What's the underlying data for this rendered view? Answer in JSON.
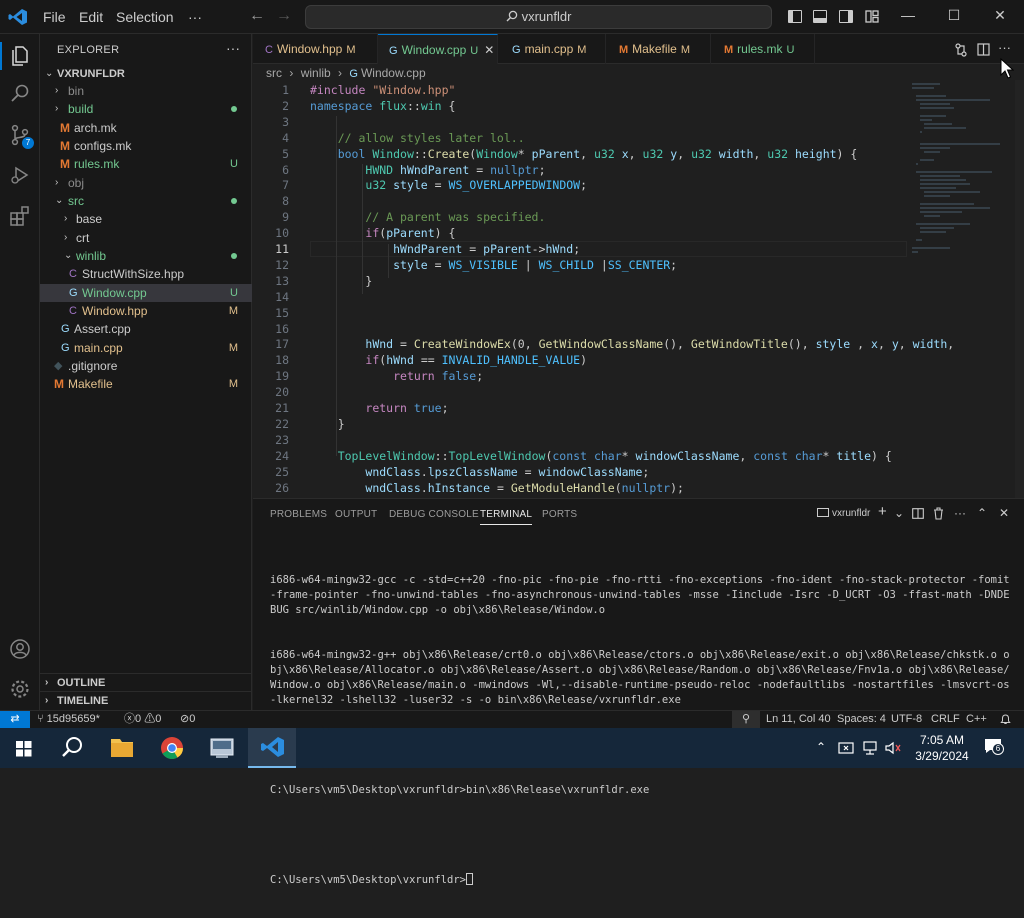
{
  "titlebar": {
    "menus": [
      "File",
      "Edit",
      "Selection"
    ],
    "more": "···",
    "back": "←",
    "forward": "→",
    "search_text": "vxrunfldr",
    "minimize": "—",
    "maximize": "☐",
    "close": "✕"
  },
  "explorer": {
    "title": "EXPLORER",
    "more": "···",
    "root": "VXRUNFLDR",
    "items": [
      {
        "label": "bin",
        "badge": ""
      },
      {
        "label": "build",
        "badge": ""
      },
      {
        "label": "arch.mk",
        "badge": ""
      },
      {
        "label": "configs.mk",
        "badge": ""
      },
      {
        "label": "rules.mk",
        "badge": "U"
      },
      {
        "label": "obj",
        "badge": ""
      },
      {
        "label": "src",
        "badge": ""
      },
      {
        "label": "base",
        "badge": ""
      },
      {
        "label": "crt",
        "badge": ""
      },
      {
        "label": "winlib",
        "badge": ""
      },
      {
        "label": "StructWithSize.hpp",
        "badge": ""
      },
      {
        "label": "Window.cpp",
        "badge": "U"
      },
      {
        "label": "Window.hpp",
        "badge": "M"
      },
      {
        "label": "Assert.cpp",
        "badge": ""
      },
      {
        "label": "main.cpp",
        "badge": "M"
      },
      {
        "label": ".gitignore",
        "badge": ""
      },
      {
        "label": "Makefile",
        "badge": "M"
      }
    ],
    "outline": "OUTLINE",
    "timeline": "TIMELINE"
  },
  "tabs": [
    {
      "label": "Window.hpp",
      "status": "M",
      "icon": "C"
    },
    {
      "label": "Window.cpp",
      "status": "U",
      "icon": "G",
      "close": "✕"
    },
    {
      "label": "main.cpp",
      "status": "M",
      "icon": "G"
    },
    {
      "label": "Makefile",
      "status": "M",
      "icon": "M"
    },
    {
      "label": "rules.mk",
      "status": "U",
      "icon": "M"
    }
  ],
  "breadcrumb": {
    "parts": [
      "src",
      "winlib",
      "Window.cpp"
    ],
    "sep": "›"
  },
  "editor": {
    "lines": [
      {
        "n": "1",
        "text": "#include \"Window.hpp\""
      },
      {
        "n": "2",
        "text": "namespace flux::win {"
      },
      {
        "n": "3",
        "text": ""
      },
      {
        "n": "4",
        "text": "    // allow styles later lol.."
      },
      {
        "n": "5",
        "text": "    bool Window::Create(Window* pParent, u32 x, u32 y, u32 width, u32 height) {"
      },
      {
        "n": "6",
        "text": "        HWND hWndParent = nullptr;"
      },
      {
        "n": "7",
        "text": "        u32 style = WS_OVERLAPPEDWINDOW;"
      },
      {
        "n": "8",
        "text": ""
      },
      {
        "n": "9",
        "text": "        // A parent was specified."
      },
      {
        "n": "10",
        "text": "        if(pParent) {"
      },
      {
        "n": "11",
        "text": "            hWndParent = pParent->hWnd;"
      },
      {
        "n": "12",
        "text": "            style = WS_VISIBLE | WS_CHILD |SS_CENTER;"
      },
      {
        "n": "13",
        "text": "        }"
      },
      {
        "n": "14",
        "text": ""
      },
      {
        "n": "15",
        "text": ""
      },
      {
        "n": "16",
        "text": ""
      },
      {
        "n": "17",
        "text": "        hWnd = CreateWindowEx(0, GetWindowClassName(), GetWindowTitle(), style , x, y, width,"
      },
      {
        "n": "18",
        "text": "        if(hWnd == INVALID_HANDLE_VALUE)"
      },
      {
        "n": "19",
        "text": "            return false;"
      },
      {
        "n": "20",
        "text": ""
      },
      {
        "n": "21",
        "text": "        return true;"
      },
      {
        "n": "22",
        "text": "    }"
      },
      {
        "n": "23",
        "text": ""
      },
      {
        "n": "24",
        "text": "    TopLevelWindow::TopLevelWindow(const char* windowClassName, const char* title) {"
      },
      {
        "n": "25",
        "text": "        wndClass.lpszClassName = windowClassName;"
      },
      {
        "n": "26",
        "text": "        wndClass.hInstance = GetModuleHandle(nullptr);"
      }
    ]
  },
  "panel": {
    "tabs": [
      "PROBLEMS",
      "OUTPUT",
      "DEBUG CONSOLE",
      "TERMINAL",
      "PORTS"
    ],
    "terminal_name": "vxrunfldr",
    "output": [
      "i686-w64-mingw32-gcc -c -std=c++20 -fno-pic -fno-pie -fno-rtti -fno-exceptions -fno-ident -fno-stack-protector -fomit-frame-pointer -fno-unwind-tables -fno-asynchronous-unwind-tables -msse -Iinclude -Isrc -D_UCRT -O3 -ffast-math -DNDEBUG src/winlib/Window.cpp -o obj\\x86\\Release/Window.o",
      "i686-w64-mingw32-g++ obj\\x86\\Release/crt0.o obj\\x86\\Release/ctors.o obj\\x86\\Release/exit.o obj\\x86\\Release/chkstk.o obj\\x86\\Release/Allocator.o obj\\x86\\Release/Assert.o obj\\x86\\Release/Random.o obj\\x86\\Release/Fnv1a.o obj\\x86\\Release/Window.o obj\\x86\\Release/main.o -mwindows -Wl,--disable-runtime-pseudo-reloc -nodefaultlibs -nostartfiles -lmsvcrt-os -lkernel32 -lshell32 -luser32 -s -o bin\\x86\\Release/vxrunfldr.exe",
      "",
      "C:\\Users\\vm5\\Desktop\\vxrunfldr>bin\\x86\\Release\\vxrunfldr.exe",
      "",
      "C:\\Users\\vm5\\Desktop\\vxrunfldr>"
    ]
  },
  "status": {
    "remote": "⇄",
    "branch": "15d95659*",
    "errors": "0",
    "warnings": "0",
    "ports": "0",
    "position": "Ln 11, Col 40",
    "spaces": "Spaces: 4",
    "encoding": "UTF-8",
    "eol": "CRLF",
    "language": "C++"
  },
  "taskbar": {
    "time": "7:05 AM",
    "date": "3/29/2024",
    "notifications": "6"
  }
}
